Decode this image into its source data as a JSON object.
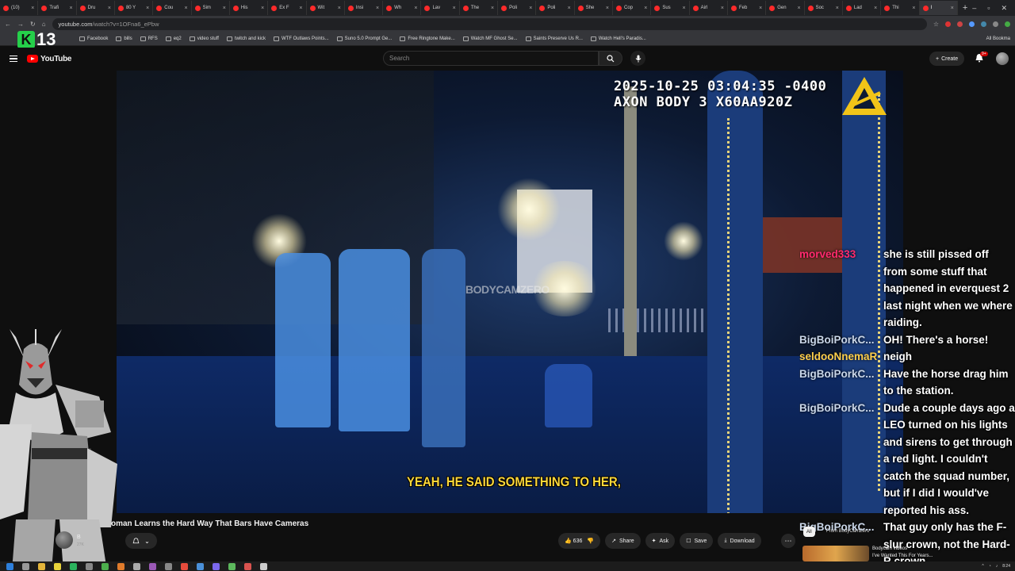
{
  "browser": {
    "tabs": [
      {
        "label": "(10)"
      },
      {
        "label": "Trafi"
      },
      {
        "label": "Dru"
      },
      {
        "label": "80 Y"
      },
      {
        "label": "Cou"
      },
      {
        "label": "Sim"
      },
      {
        "label": "His"
      },
      {
        "label": "Ex F"
      },
      {
        "label": "Wit"
      },
      {
        "label": "Insi"
      },
      {
        "label": "Wh"
      },
      {
        "label": "Lav"
      },
      {
        "label": "The"
      },
      {
        "label": "Poli"
      },
      {
        "label": "Poli"
      },
      {
        "label": "She"
      },
      {
        "label": "Cop"
      },
      {
        "label": "Sus"
      },
      {
        "label": "Airl"
      },
      {
        "label": "Feb"
      },
      {
        "label": "Gen"
      },
      {
        "label": "Soc"
      },
      {
        "label": "Lad"
      },
      {
        "label": "Thi"
      },
      {
        "label": "I"
      }
    ],
    "url_host": "youtube.com",
    "url_path": "/watch?v=1OFna6_ePbw",
    "bookmarks": [
      "Facebook",
      "bills",
      "RFS",
      "eq2",
      "video stuff",
      "twitch and kick",
      "WTF Outlaws Points...",
      "Suno 5.0 Prompt Ge...",
      "Free Ringtone Make...",
      "Watch MF Ghost Se...",
      "Saints Preserve Us R...",
      "Watch Hell's Paradis..."
    ],
    "all_bookmarks": "All Bookma"
  },
  "stream_overlay": {
    "k_letter": "K",
    "k_number": "13"
  },
  "youtube": {
    "logo": "YouTube",
    "search_placeholder": "Search",
    "create_label": "Create",
    "notif_count": "9+"
  },
  "video": {
    "timestamp_line1": "2025-10-25 03:04:35 -0400",
    "timestamp_line2": "AXON BODY 3 X60AA920Z",
    "watermark": "BODYCAMZERO",
    "caption": "YEAH, HE SAID SOMETHING TO HER,",
    "title": "oman Learns the Hard Way That Bars Have Cameras",
    "channel_name": "B",
    "channel_subs": "27K",
    "likes": "636",
    "share_label": "Share",
    "ask_label": "Ask",
    "save_label": "Save",
    "download_label": "Download"
  },
  "chat": [
    {
      "user": "morved333",
      "text": "she is still pissed off from some stuff that happened in everquest 2 last night when we where raiding.",
      "color": "#ff2a6d"
    },
    {
      "user": "BigBoiPorkC...",
      "text": "OH! There's a horse!",
      "color": "#c9d6e8"
    },
    {
      "user": "seldooNnemaR",
      "text": "neigh",
      "color": "#ffcf4a"
    },
    {
      "user": "BigBoiPorkC...",
      "text": "Have the horse drag him to the station.",
      "color": "#c9d6e8"
    },
    {
      "user": "BigBoiPorkC...",
      "text": "Dude a couple days ago a LEO turned on his lights and sirens to get through a red light. I couldn't catch the squad number, but if I did I would've reported his ass.",
      "color": "#c9d6e8"
    },
    {
      "user": "BigBoiPorkC...",
      "text": "That guy only has the F-slur crown, not the Hard-R crown.",
      "color": "#c9d6e8"
    }
  ],
  "recommendations": {
    "chip_all": "All",
    "chip_from": "From BodyCamZero",
    "chip_sub": "Bodycam videos",
    "item_title": "I've Wanted This For Years..."
  },
  "taskbar": {
    "time": "8:24"
  }
}
